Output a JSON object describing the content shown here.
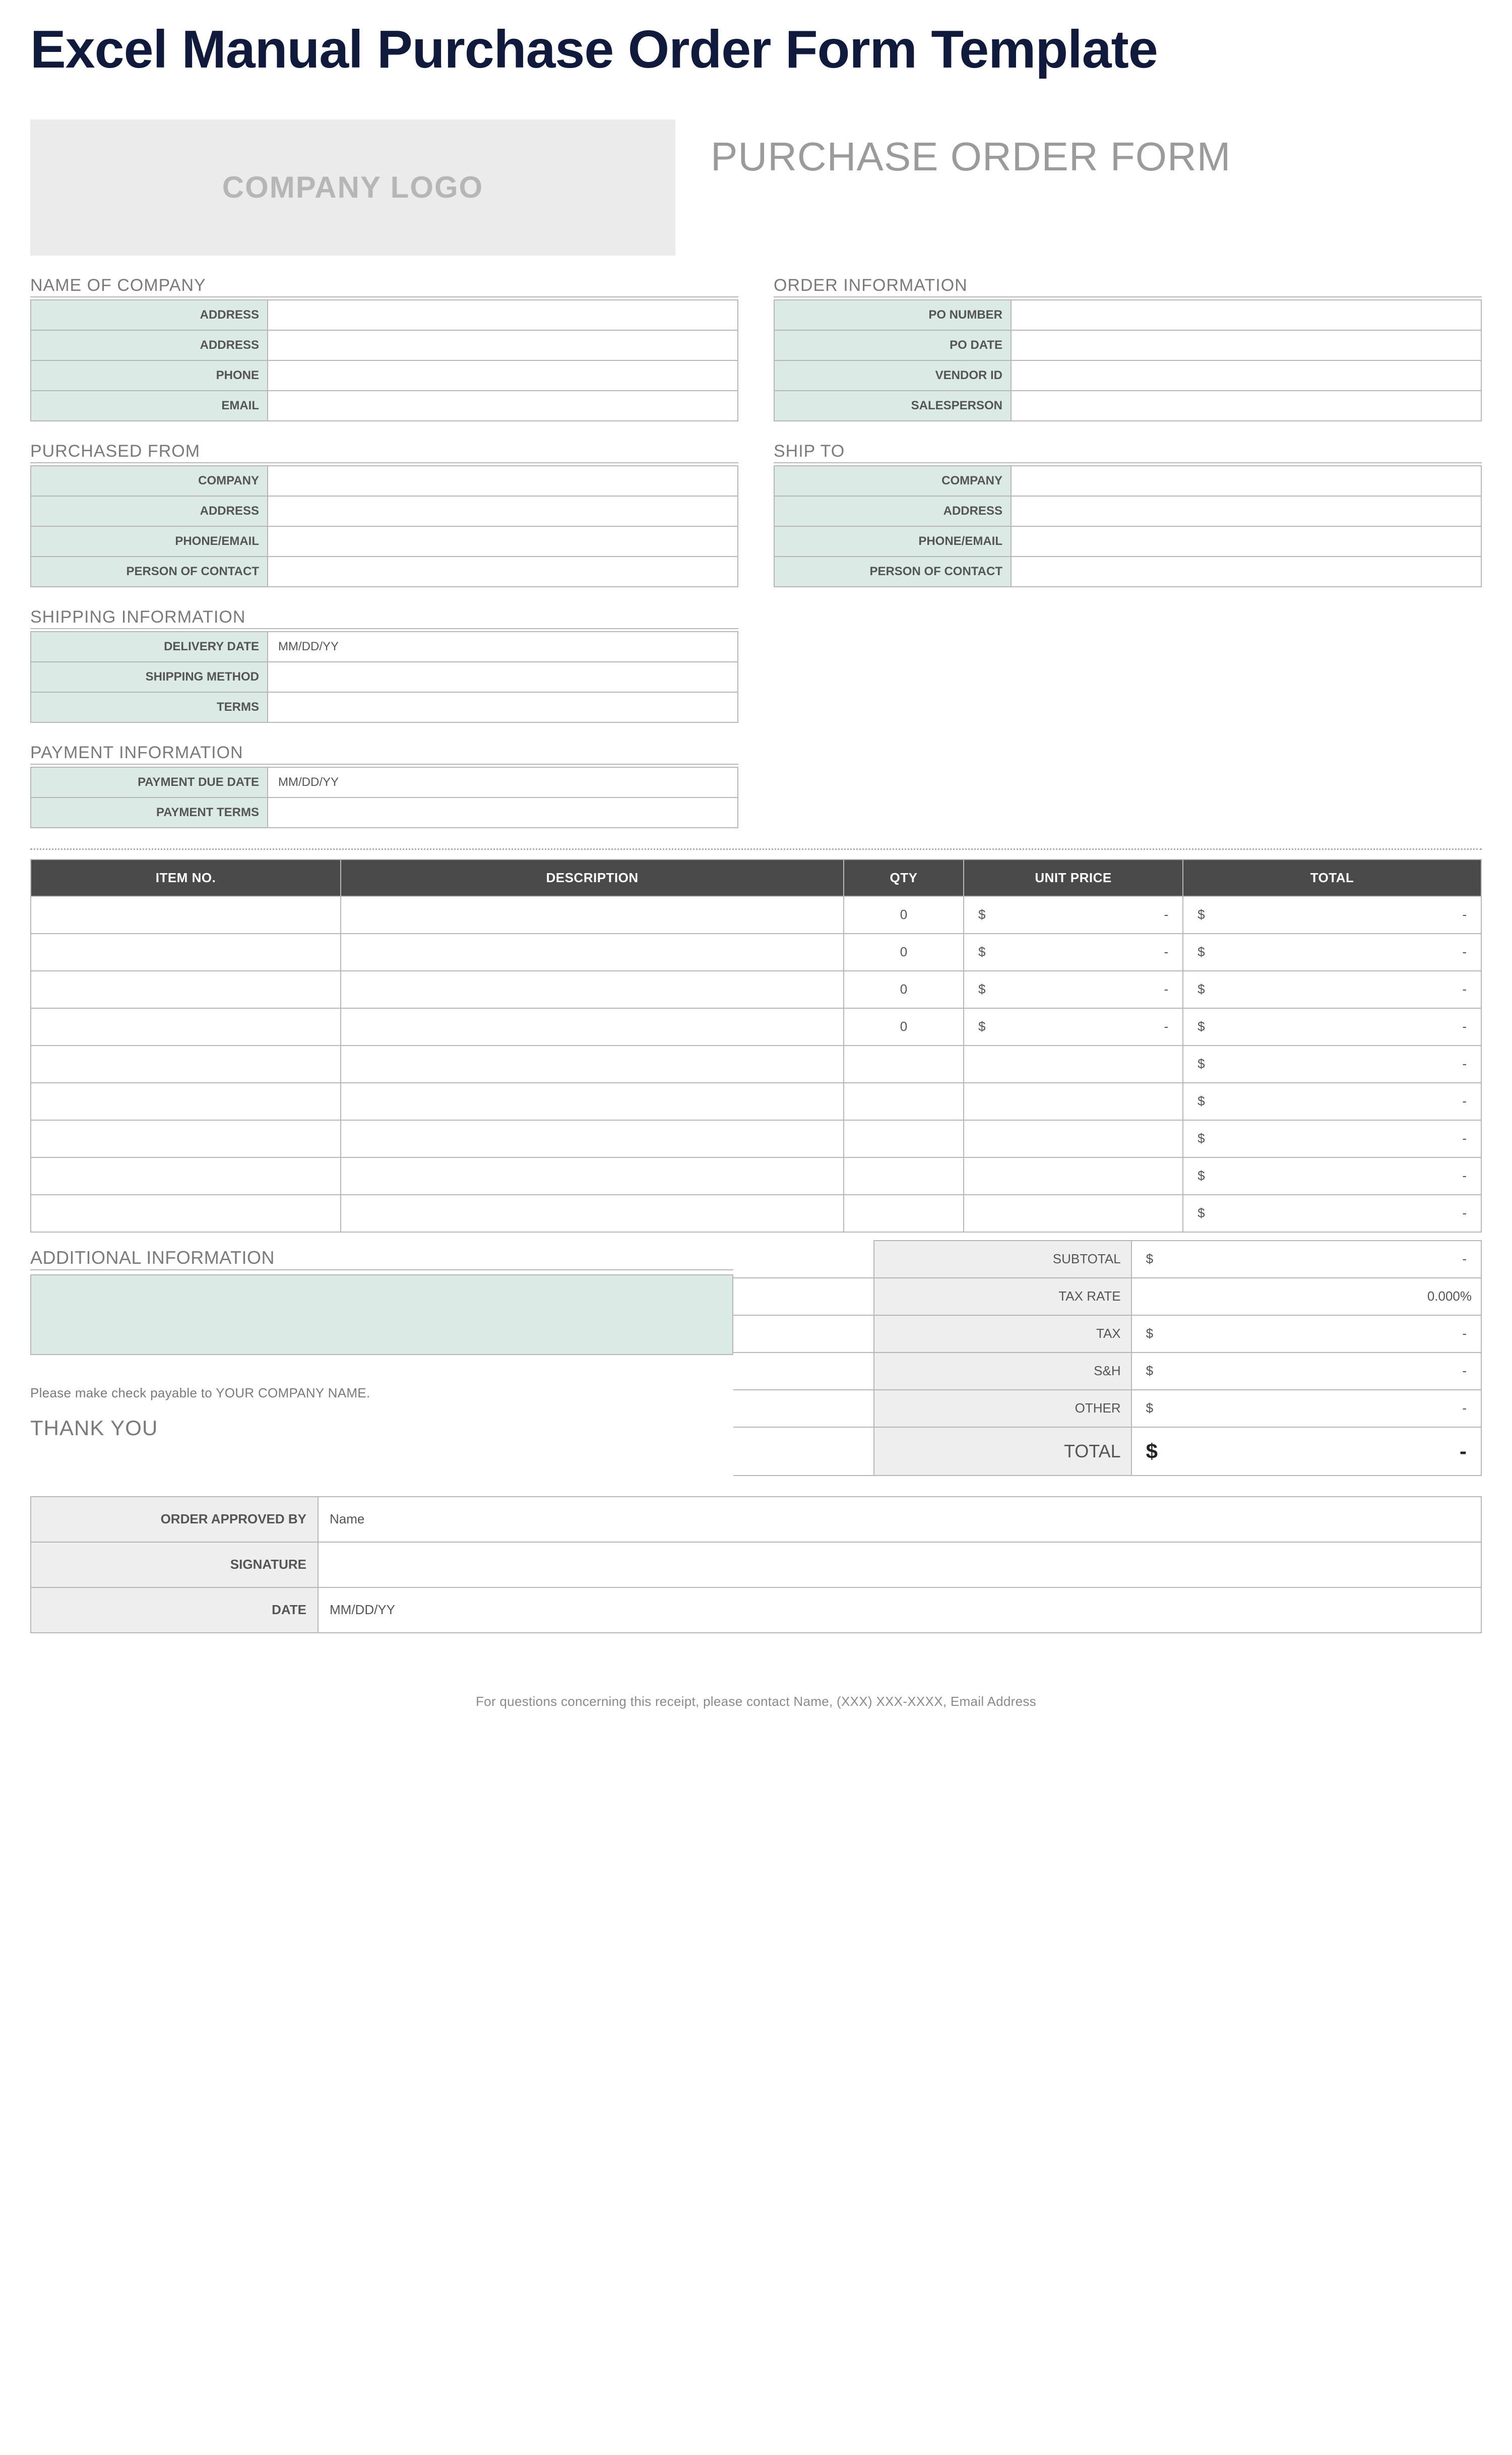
{
  "page_title": "Excel Manual Purchase Order Form Template",
  "header": {
    "logo_text": "COMPANY LOGO",
    "form_title": "PURCHASE ORDER FORM"
  },
  "company_section": {
    "title": "NAME OF COMPANY",
    "rows": [
      {
        "label": "ADDRESS",
        "value": ""
      },
      {
        "label": "ADDRESS",
        "value": ""
      },
      {
        "label": "PHONE",
        "value": ""
      },
      {
        "label": "EMAIL",
        "value": ""
      }
    ]
  },
  "order_info_section": {
    "title": "ORDER INFORMATION",
    "rows": [
      {
        "label": "PO NUMBER",
        "value": ""
      },
      {
        "label": "PO DATE",
        "value": ""
      },
      {
        "label": "VENDOR ID",
        "value": ""
      },
      {
        "label": "SALESPERSON",
        "value": ""
      }
    ]
  },
  "purchased_from_section": {
    "title": "PURCHASED FROM",
    "rows": [
      {
        "label": "COMPANY",
        "value": ""
      },
      {
        "label": "ADDRESS",
        "value": ""
      },
      {
        "label": "PHONE/EMAIL",
        "value": ""
      },
      {
        "label": "PERSON OF CONTACT",
        "value": ""
      }
    ]
  },
  "ship_to_section": {
    "title": "SHIP TO",
    "rows": [
      {
        "label": "COMPANY",
        "value": ""
      },
      {
        "label": "ADDRESS",
        "value": ""
      },
      {
        "label": "PHONE/EMAIL",
        "value": ""
      },
      {
        "label": "PERSON OF CONTACT",
        "value": ""
      }
    ]
  },
  "shipping_info_section": {
    "title": "SHIPPING INFORMATION",
    "rows": [
      {
        "label": "DELIVERY DATE",
        "value": "MM/DD/YY"
      },
      {
        "label": "SHIPPING METHOD",
        "value": ""
      },
      {
        "label": "TERMS",
        "value": ""
      }
    ]
  },
  "payment_info_section": {
    "title": "PAYMENT INFORMATION",
    "rows": [
      {
        "label": "PAYMENT DUE DATE",
        "value": "MM/DD/YY"
      },
      {
        "label": "PAYMENT TERMS",
        "value": ""
      }
    ]
  },
  "items_table": {
    "headers": {
      "item_no": "ITEM NO.",
      "description": "DESCRIPTION",
      "qty": "QTY",
      "unit_price": "UNIT PRICE",
      "total": "TOTAL"
    },
    "rows": [
      {
        "item_no": "",
        "description": "",
        "qty": "0",
        "unit_sym": "$",
        "unit_val": "-",
        "total_sym": "$",
        "total_val": "-"
      },
      {
        "item_no": "",
        "description": "",
        "qty": "0",
        "unit_sym": "$",
        "unit_val": "-",
        "total_sym": "$",
        "total_val": "-"
      },
      {
        "item_no": "",
        "description": "",
        "qty": "0",
        "unit_sym": "$",
        "unit_val": "-",
        "total_sym": "$",
        "total_val": "-"
      },
      {
        "item_no": "",
        "description": "",
        "qty": "0",
        "unit_sym": "$",
        "unit_val": "-",
        "total_sym": "$",
        "total_val": "-"
      },
      {
        "item_no": "",
        "description": "",
        "qty": "",
        "unit_sym": "",
        "unit_val": "",
        "total_sym": "$",
        "total_val": "-"
      },
      {
        "item_no": "",
        "description": "",
        "qty": "",
        "unit_sym": "",
        "unit_val": "",
        "total_sym": "$",
        "total_val": "-"
      },
      {
        "item_no": "",
        "description": "",
        "qty": "",
        "unit_sym": "",
        "unit_val": "",
        "total_sym": "$",
        "total_val": "-"
      },
      {
        "item_no": "",
        "description": "",
        "qty": "",
        "unit_sym": "",
        "unit_val": "",
        "total_sym": "$",
        "total_val": "-"
      },
      {
        "item_no": "",
        "description": "",
        "qty": "",
        "unit_sym": "",
        "unit_val": "",
        "total_sym": "$",
        "total_val": "-"
      }
    ]
  },
  "additional_info": {
    "title": "ADDITIONAL INFORMATION",
    "value": ""
  },
  "payable_note": "Please make check payable to YOUR COMPANY NAME.",
  "thank_you": "THANK YOU",
  "totals": {
    "subtotal": {
      "label": "SUBTOTAL",
      "sym": "$",
      "val": "-"
    },
    "tax_rate": {
      "label": "TAX RATE",
      "val": "0.000%"
    },
    "tax": {
      "label": "TAX",
      "sym": "$",
      "val": "-"
    },
    "sh": {
      "label": "S&H",
      "sym": "$",
      "val": "-"
    },
    "other": {
      "label": "OTHER",
      "sym": "$",
      "val": "-"
    },
    "grand": {
      "label": "TOTAL",
      "sym": "$",
      "val": "-"
    }
  },
  "approval": {
    "rows": [
      {
        "label": "ORDER APPROVED BY",
        "value": "Name"
      },
      {
        "label": "SIGNATURE",
        "value": ""
      },
      {
        "label": "DATE",
        "value": "MM/DD/YY"
      }
    ]
  },
  "footer": "For questions concerning this receipt, please contact Name, (XXX) XXX-XXXX, Email Address"
}
